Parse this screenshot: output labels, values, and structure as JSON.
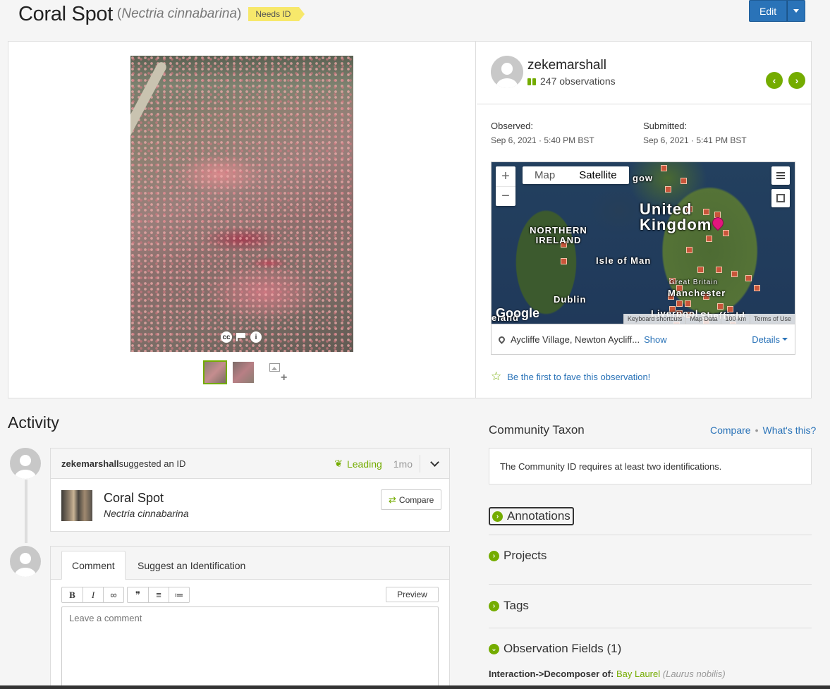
{
  "header": {
    "common_name": "Coral Spot",
    "sci_name": "Nectria cinnabarina",
    "paren_open": "(",
    "paren_close": ")",
    "badge": "Needs ID",
    "edit_label": "Edit"
  },
  "observer": {
    "username": "zekemarshall",
    "observations": "247 observations"
  },
  "dates": {
    "observed_label": "Observed:",
    "observed_value": "Sep 6, 2021 · 5:40 PM BST",
    "submitted_label": "Submitted:",
    "submitted_value": "Sep 6, 2021 · 5:41 PM BST"
  },
  "map": {
    "tab_map": "Map",
    "tab_satellite": "Satellite",
    "active_tab": "Satellite",
    "zoom_in": "+",
    "zoom_out": "−",
    "labels": {
      "uk": "United Kingdom",
      "ni": "NORTHERN IRELAND",
      "iom": "Isle of Man",
      "dublin": "Dublin",
      "glasgow": "gow",
      "manchester": "Manchester",
      "gb": "Great Britain",
      "liverpool": "Liverpool",
      "sheffield": "Sheffield",
      "ireland": "eland"
    },
    "google": "Google",
    "footer": [
      "Keyboard shortcuts",
      "Map Data",
      "100 km",
      "Terms of Use"
    ]
  },
  "location": {
    "place": "Aycliffe Village, Newton Aycliff...",
    "show": "Show",
    "details": "Details"
  },
  "fave": "Be the first to fave this observation!",
  "activity": {
    "title": "Activity",
    "id_card": {
      "user": "zekemarshall",
      "action": " suggested an ID",
      "status": "Leading",
      "time": "1mo",
      "taxon_common": "Coral Spot",
      "taxon_sci": "Nectria cinnabarina",
      "compare": "Compare"
    },
    "comment": {
      "tab_comment": "Comment",
      "tab_suggest": "Suggest an Identification",
      "toolbar": [
        "B",
        "I",
        "∞",
        "❞",
        "≡",
        "≔"
      ],
      "preview": "Preview",
      "placeholder": "Leave a comment"
    }
  },
  "community": {
    "title": "Community Taxon",
    "compare": "Compare",
    "whats_this": "What's this?",
    "dot": "•",
    "message": "The Community ID requires at least two identifications."
  },
  "sections": {
    "annotations": "Annotations",
    "projects": "Projects",
    "tags": "Tags",
    "observation_fields": "Observation Fields (1)"
  },
  "field": {
    "name": "Interaction->Decomposer of:",
    "value": "Bay Laurel",
    "sci": "Laurus nobilis"
  },
  "colors": {
    "accent_green": "#74ac00",
    "link_blue": "#2a73b8",
    "badge_yellow": "#f7e86b",
    "edit_blue": "#2a73b8"
  }
}
